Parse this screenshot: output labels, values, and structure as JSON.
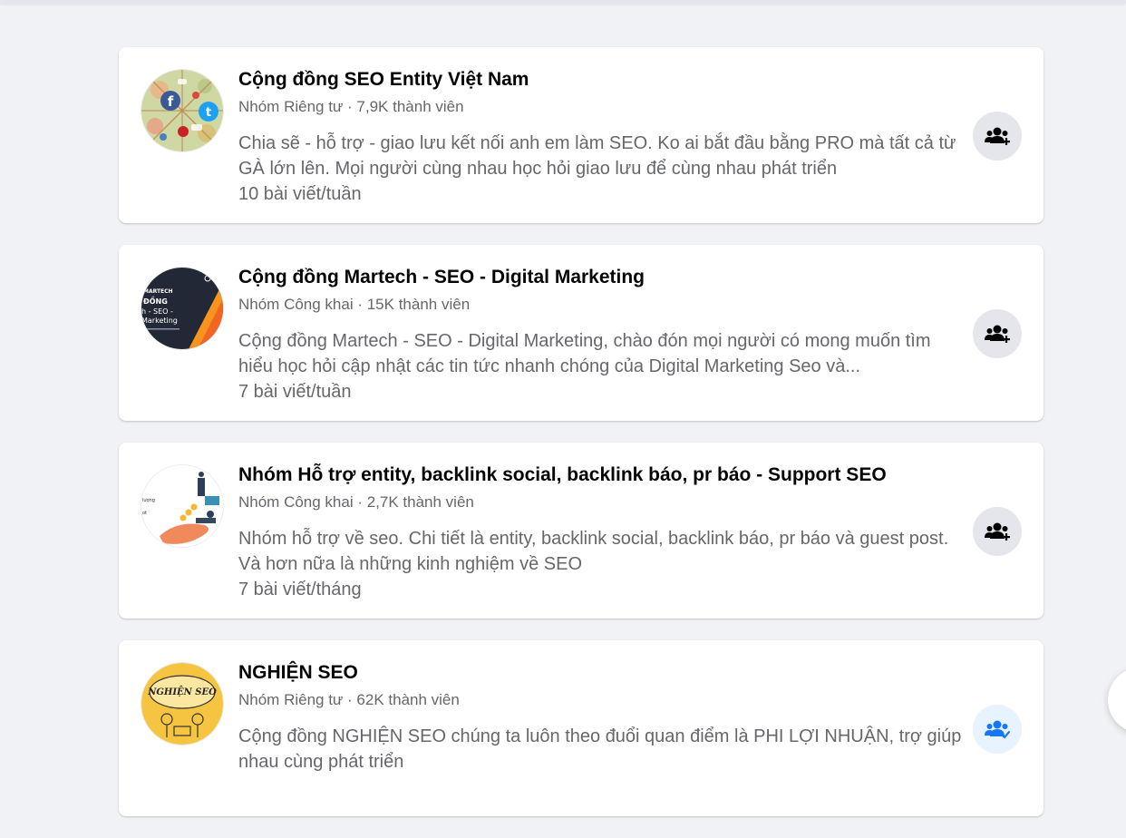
{
  "groups": [
    {
      "name": "Cộng đồng SEO Entity Việt Nam",
      "meta": "Nhóm Riêng tư · 7,9K thành viên",
      "description": "Chia sẽ - hỗ trợ - giao lưu kết nối anh em làm SEO. Ko ai bắt đầu bằng PRO mà tất cả từ GÀ lớn lên. Mọi người cùng nhau học hỏi giao lưu để cùng nhau phát triển",
      "frequency": "10 bài viết/tuần",
      "action_icon": "group-join-icon",
      "joined": false
    },
    {
      "name": "Cộng đồng Martech - SEO - Digital Marketing",
      "meta": "Nhóm Công khai · 15K thành viên",
      "description": "Cộng đồng Martech - SEO - Digital Marketing, chào đón mọi người có mong muốn tìm hiểu học hỏi cập nhật các tin tức nhanh chóng của Digital Marketing Seo và...",
      "frequency": "7 bài viết/tuần",
      "avatar_text": [
        "MARTECH",
        "ĐỒNG",
        "h - SEO -",
        "Marketing"
      ],
      "action_icon": "group-join-icon",
      "joined": false
    },
    {
      "name": "Nhóm Hỗ trợ entity, backlink social, backlink báo, pr báo - Support SEO",
      "meta": "Nhóm Công khai · 2,7K thành viên",
      "description": "Nhóm hỗ trợ về seo. Chi tiết là entity, backlink social, backlink báo, pr báo và guest post. Và hơn nữa là những kinh nghiệm về SEO",
      "frequency": "7 bài viết/tháng",
      "avatar_text": [
        "lượng",
        "ot"
      ],
      "action_icon": "group-join-icon",
      "joined": false
    },
    {
      "name": "NGHIỆN SEO",
      "meta": "Nhóm Riêng tư · 62K thành viên",
      "description": "Cộng đồng NGHIỆN SEO chúng ta luôn theo đuổi quan điểm là PHI LỢI NHUẬN, trợ giúp nhau cùng phát triển",
      "frequency": "",
      "avatar_text": [
        "NGHIỆN SEO"
      ],
      "action_icon": "group-joined-icon",
      "joined": true
    }
  ],
  "colors": {
    "page_bg": "#f0f2f5",
    "card_bg": "#ffffff",
    "primary_text": "#050505",
    "secondary_text": "#65676b",
    "button_bg": "#e4e6eb",
    "joined_blue": "#1877f2"
  }
}
